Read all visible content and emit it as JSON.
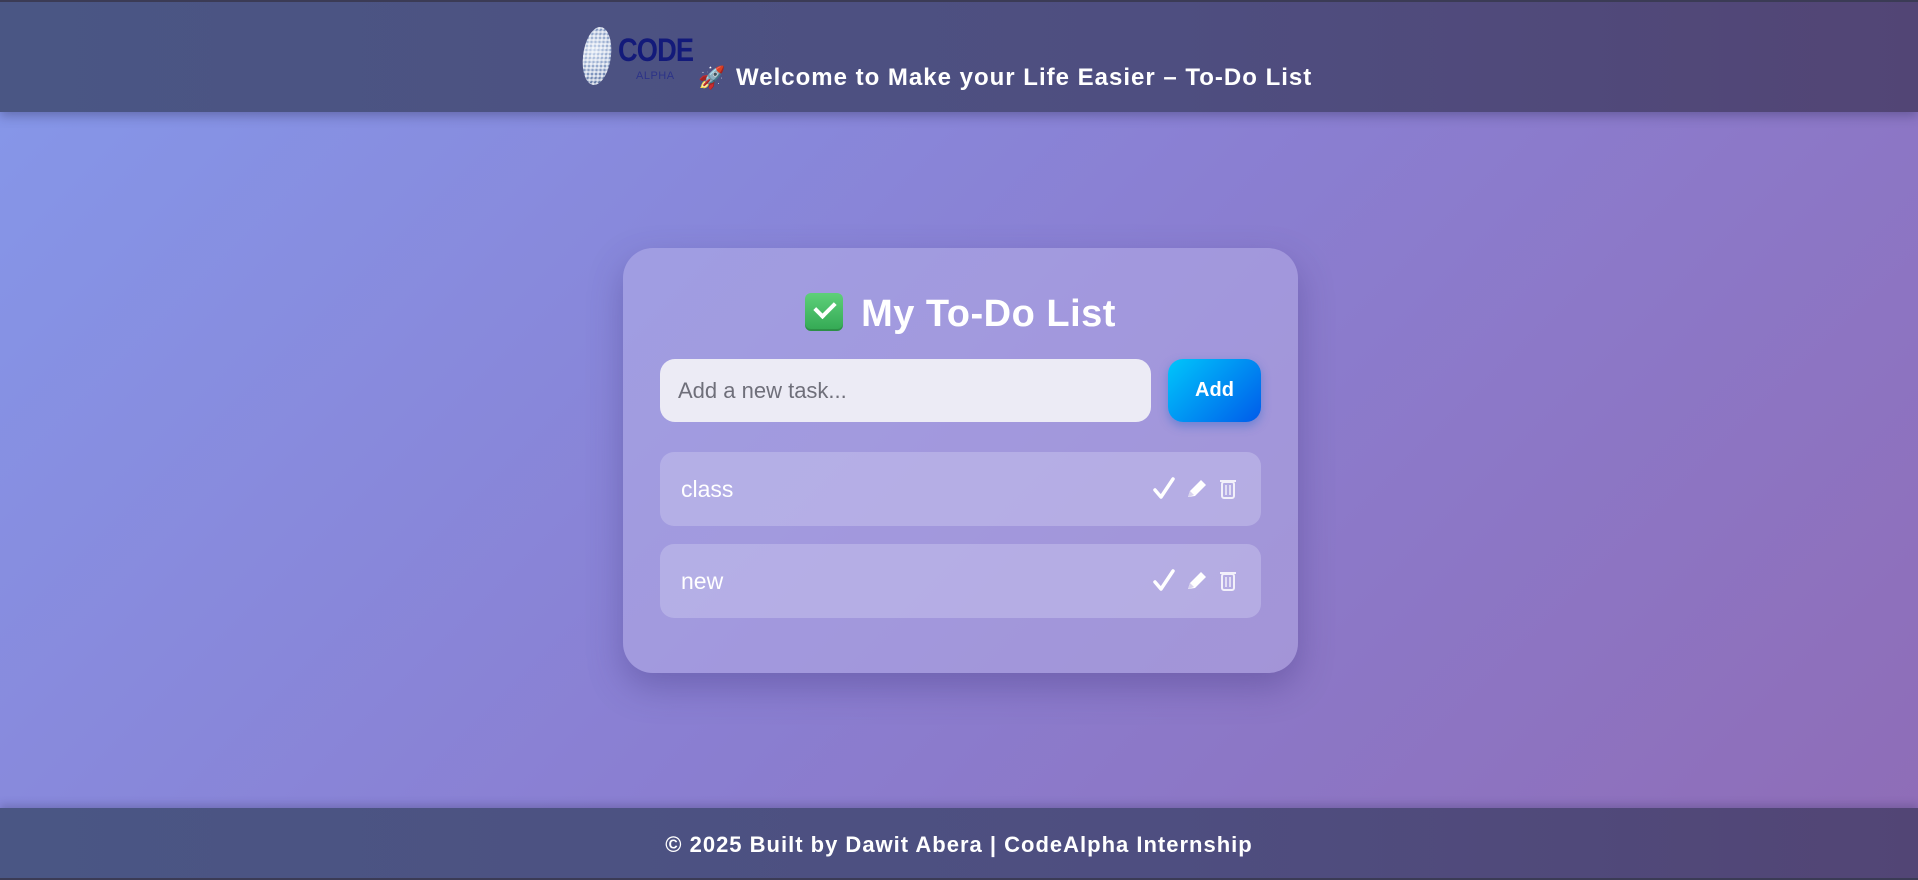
{
  "header": {
    "logo_text": "CODE",
    "logo_subtext": "ALPHA",
    "rocket_glyph": "🚀",
    "title": "Welcome to Make your Life Easier – To-Do List"
  },
  "card": {
    "title": "My To-Do List",
    "input_placeholder": "Add a new task...",
    "add_label": "Add",
    "tasks": [
      {
        "text": "class"
      },
      {
        "text": "new"
      }
    ]
  },
  "footer": {
    "text": "© 2025 Built by Dawit Abera | CodeAlpha Internship"
  },
  "colors": {
    "accent_button_start": "#00c6fb",
    "accent_button_end": "#005bea",
    "check_green": "#33a853"
  }
}
